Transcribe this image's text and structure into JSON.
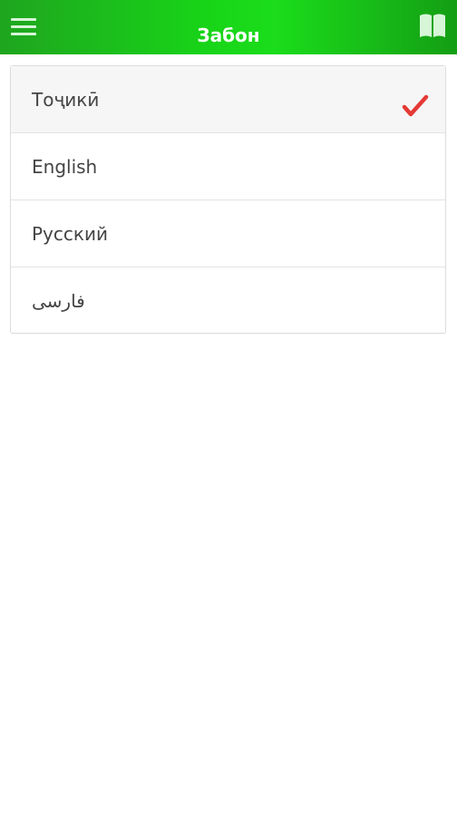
{
  "app_bar": {
    "title": "Забон",
    "menu_icon": "hamburger-menu-icon",
    "book_icon": "open-book-icon",
    "colors": {
      "start": "#1fa51f",
      "middle": "#18d418",
      "end": "#149e14"
    }
  },
  "languages": {
    "items": [
      {
        "label": "Тоҷикӣ",
        "selected": true
      },
      {
        "label": "English",
        "selected": false
      },
      {
        "label": "Русский",
        "selected": false
      },
      {
        "label": "فارسی",
        "selected": false
      }
    ],
    "selected_indicator": "red-checkmark-icon",
    "check_color": "#e53935"
  }
}
